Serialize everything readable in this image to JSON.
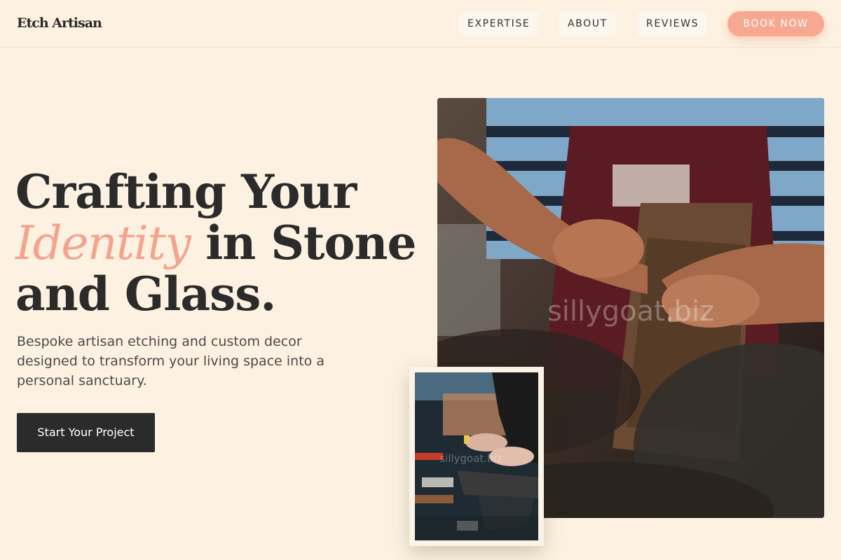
{
  "header": {
    "logo": "Etch Artisan",
    "nav": [
      {
        "label": "EXPERTISE"
      },
      {
        "label": "ABOUT"
      },
      {
        "label": "REVIEWS"
      }
    ],
    "cta_label": "BOOK NOW"
  },
  "hero": {
    "title_line1": "Crafting Your",
    "title_accent": "Identity",
    "title_line2_rest": " in Stone",
    "title_line3": "and Glass.",
    "subtitle": "Bespoke artisan etching and custom decor designed to transform your living space into a personal sanctuary.",
    "cta_label": "Start Your Project"
  },
  "images": {
    "main_watermark": "sillygoat.biz",
    "small_watermark": "sillygoat.biz"
  },
  "colors": {
    "background": "#fdf2e1",
    "accent": "#f4a48e",
    "dark": "#2b2b2b"
  }
}
